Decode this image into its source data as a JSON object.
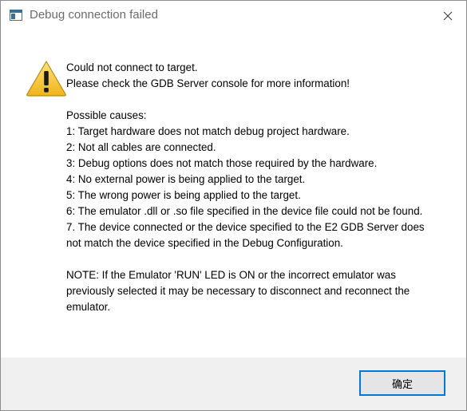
{
  "window": {
    "title": "Debug connection failed",
    "close_glyph": "✕"
  },
  "message": {
    "lines": [
      "Could not connect to target.",
      "Please check the GDB Server console for more information!",
      "",
      "Possible causes:",
      "1: Target hardware does not match debug project hardware.",
      "2: Not all cables are connected.",
      "3: Debug options does not match those required by the hardware.",
      "4: No external power is being applied to the target.",
      "5: The wrong power is being applied to the target.",
      "6: The emulator .dll or .so file specified in the device file could not be found.",
      "7. The device connected or the device specified to the E2 GDB Server does not match the device specified in the Debug Configuration.",
      "",
      "NOTE: If the Emulator 'RUN' LED is ON or the incorrect emulator was previously selected it may be necessary to disconnect and reconnect the emulator."
    ]
  },
  "footer": {
    "ok_label": "确定"
  },
  "icons": {
    "app": "window-app-icon",
    "warning": "warning-icon",
    "close": "close-icon"
  },
  "colors": {
    "accent": "#0078d7",
    "warning_fill": "#f5c432",
    "footer_bg": "#f0f0f0"
  }
}
